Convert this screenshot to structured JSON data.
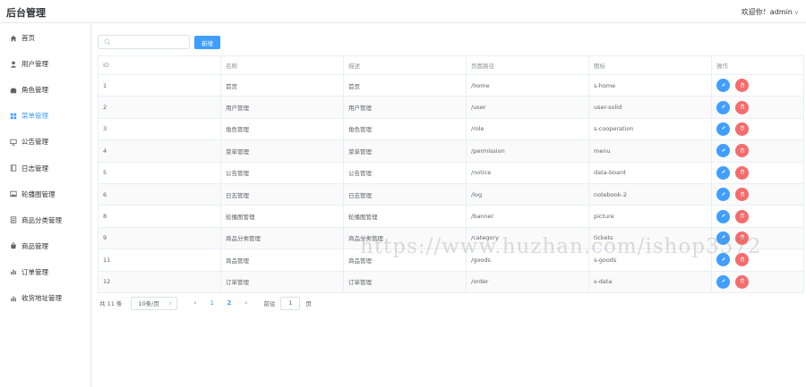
{
  "header": {
    "brand": "后台管理",
    "user_greeting": "欢迎你！admin"
  },
  "sidebar": {
    "items": [
      {
        "label": "首页",
        "icon": "home-icon",
        "active": false
      },
      {
        "label": "用户管理",
        "icon": "user-icon",
        "active": false
      },
      {
        "label": "角色管理",
        "icon": "role-icon",
        "active": false
      },
      {
        "label": "菜单管理",
        "icon": "menu-grid-icon",
        "active": true
      },
      {
        "label": "公告管理",
        "icon": "monitor-icon",
        "active": false
      },
      {
        "label": "日志管理",
        "icon": "notebook-icon",
        "active": false
      },
      {
        "label": "轮播图管理",
        "icon": "picture-icon",
        "active": false
      },
      {
        "label": "商品分类管理",
        "icon": "ticket-icon",
        "active": false
      },
      {
        "label": "商品管理",
        "icon": "goods-icon",
        "active": false
      },
      {
        "label": "订单管理",
        "icon": "data-icon",
        "active": false
      },
      {
        "label": "收货地址管理",
        "icon": "data-icon",
        "active": false
      }
    ]
  },
  "toolbar": {
    "search_placeholder": "",
    "add_label": "新增"
  },
  "table": {
    "columns": [
      "ID",
      "名称",
      "描述",
      "页面路径",
      "图标",
      "操作"
    ],
    "rows": [
      [
        "1",
        "首页",
        "首页",
        "/home",
        "s-home"
      ],
      [
        "2",
        "用户管理",
        "用户管理",
        "/user",
        "user-solid"
      ],
      [
        "3",
        "角色管理",
        "角色管理",
        "/role",
        "s-cooperation"
      ],
      [
        "4",
        "菜单管理",
        "菜单管理",
        "/permission",
        "menu"
      ],
      [
        "5",
        "公告管理",
        "公告管理",
        "/notice",
        "data-board"
      ],
      [
        "6",
        "日志管理",
        "日志管理",
        "/log",
        "notebook-2"
      ],
      [
        "8",
        "轮播图管理",
        "轮播图管理",
        "/banner",
        "picture"
      ],
      [
        "9",
        "商品分类管理",
        "商品分类管理",
        "/category",
        "tickets"
      ],
      [
        "11",
        "商品管理",
        "商品管理",
        "/goods",
        "s-goods"
      ],
      [
        "12",
        "订单管理",
        "订单管理",
        "/order",
        "s-data"
      ]
    ]
  },
  "pagination": {
    "total": "共 11 条",
    "page_size": "10条/页",
    "pages": [
      "1",
      "2"
    ],
    "current": "2",
    "goto_prefix": "前往",
    "goto_value": "1",
    "goto_suffix": "页"
  },
  "watermark": "https://www.huzhan.com/ishop3572",
  "colors": {
    "primary": "#409eff",
    "danger": "#f56c6c",
    "border": "#ebeef5"
  }
}
